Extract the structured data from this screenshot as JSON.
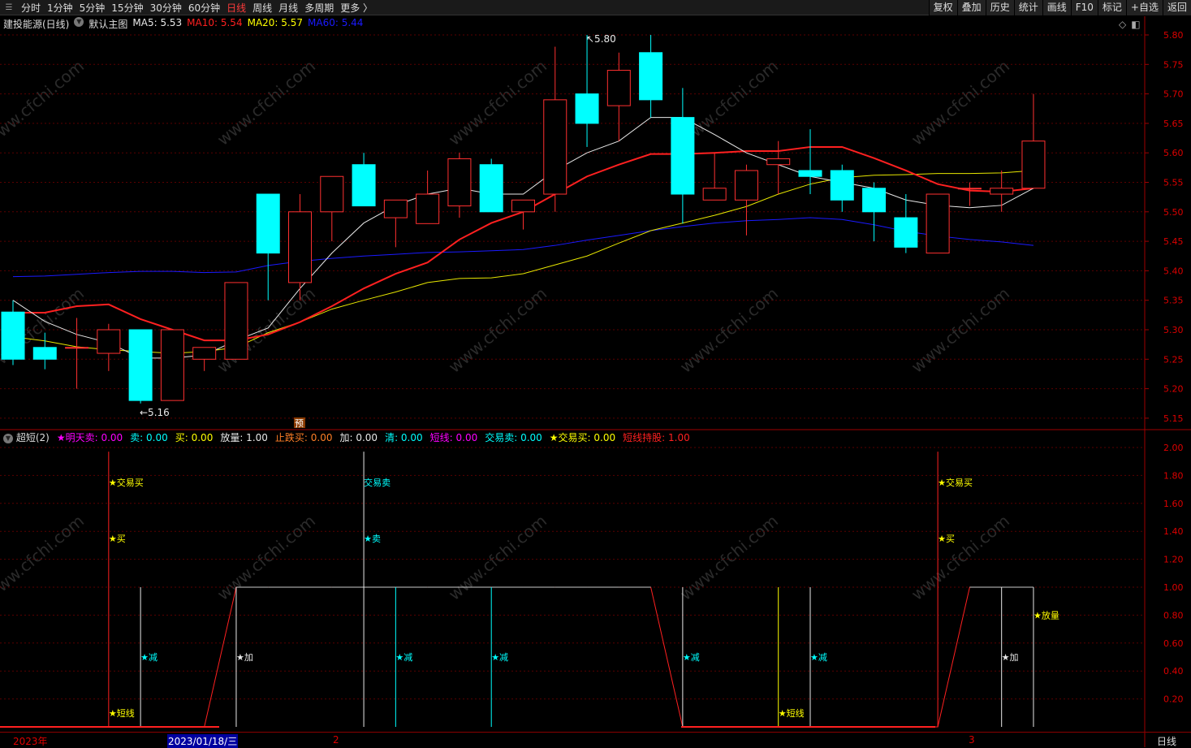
{
  "topbar": {
    "periods": [
      "分时",
      "1分钟",
      "5分钟",
      "15分钟",
      "30分钟",
      "60分钟",
      "日线",
      "周线",
      "月线",
      "多周期",
      "更多 〉"
    ],
    "active_index": 6,
    "buttons": [
      "复权",
      "叠加",
      "历史",
      "统计",
      "画线",
      "F10",
      "标记",
      "+自选",
      "返回"
    ]
  },
  "main": {
    "title": "建投能源(日线)",
    "indicator": "默认主图",
    "ma": [
      {
        "label": "MA5: 5.53",
        "color": "#e8e8e8"
      },
      {
        "label": "MA10: 5.54",
        "color": "#ff2020"
      },
      {
        "label": "MA20: 5.57",
        "color": "#ffff00"
      },
      {
        "label": "MA60: 5.44",
        "color": "#1a1aff"
      }
    ],
    "high_label": "5.80",
    "low_label": "5.16",
    "marker": "预",
    "yticks": [
      "5.80",
      "5.75",
      "5.70",
      "5.65",
      "5.60",
      "5.55",
      "5.50",
      "5.45",
      "5.40",
      "5.35",
      "5.30",
      "5.25",
      "5.20",
      "5.15"
    ]
  },
  "sub": {
    "title": "超短(2)",
    "items": [
      {
        "label": "★明天卖: 0.00",
        "color": "#ff00ff"
      },
      {
        "label": "卖: 0.00",
        "color": "#00ffff"
      },
      {
        "label": "买: 0.00",
        "color": "#ffff00"
      },
      {
        "label": "放量: 1.00",
        "color": "#e8e8e8"
      },
      {
        "label": "止跌买: 0.00",
        "color": "#ff7f27"
      },
      {
        "label": "加: 0.00",
        "color": "#e8e8e8"
      },
      {
        "label": "清: 0.00",
        "color": "#00ffff"
      },
      {
        "label": "短线: 0.00",
        "color": "#ff00ff"
      },
      {
        "label": "交易卖: 0.00",
        "color": "#00ffff"
      },
      {
        "label": "★交易买: 0.00",
        "color": "#ffff00"
      },
      {
        "label": "短线持股: 1.00",
        "color": "#ff2020"
      }
    ],
    "yticks": [
      "2.00",
      "1.80",
      "1.60",
      "1.40",
      "1.20",
      "1.00",
      "0.80",
      "0.60",
      "0.40",
      "0.20"
    ]
  },
  "timeaxis": {
    "year": "2023年",
    "selected": "2023/01/18/三",
    "m2": "2",
    "m3": "3",
    "period": "日线"
  },
  "watermark": "www.cfchi.com",
  "chart_data": {
    "type": "candlestick",
    "ylim": [
      5.15,
      5.8
    ],
    "candles": [
      [
        5.33,
        5.25,
        5.35,
        5.24
      ],
      [
        5.27,
        5.25,
        5.295,
        5.233
      ],
      [
        5.27,
        5.27,
        5.32,
        5.2
      ],
      [
        5.26,
        5.3,
        5.31,
        5.23
      ],
      [
        5.3,
        5.18,
        5.3,
        5.175
      ],
      [
        5.18,
        5.3,
        5.3,
        5.18
      ],
      [
        5.25,
        5.27,
        5.27,
        5.23
      ],
      [
        5.25,
        5.38,
        5.38,
        5.25
      ],
      [
        5.53,
        5.43,
        5.53,
        5.35
      ],
      [
        5.38,
        5.5,
        5.53,
        5.35
      ],
      [
        5.5,
        5.56,
        5.56,
        5.45
      ],
      [
        5.58,
        5.51,
        5.6,
        5.51
      ],
      [
        5.49,
        5.52,
        5.52,
        5.44
      ],
      [
        5.48,
        5.53,
        5.57,
        5.48
      ],
      [
        5.51,
        5.59,
        5.6,
        5.49
      ],
      [
        5.58,
        5.5,
        5.59,
        5.5
      ],
      [
        5.5,
        5.52,
        5.52,
        5.47
      ],
      [
        5.53,
        5.69,
        5.78,
        5.5
      ],
      [
        5.7,
        5.65,
        5.8,
        5.61
      ],
      [
        5.68,
        5.74,
        5.77,
        5.62
      ],
      [
        5.77,
        5.69,
        5.8,
        5.66
      ],
      [
        5.66,
        5.53,
        5.71,
        5.48
      ],
      [
        5.52,
        5.54,
        5.6,
        5.52
      ],
      [
        5.52,
        5.57,
        5.58,
        5.46
      ],
      [
        5.58,
        5.59,
        5.62,
        5.53
      ],
      [
        5.57,
        5.56,
        5.64,
        5.53
      ],
      [
        5.57,
        5.52,
        5.58,
        5.5
      ],
      [
        5.54,
        5.5,
        5.55,
        5.45
      ],
      [
        5.49,
        5.44,
        5.53,
        5.43
      ],
      [
        5.43,
        5.53,
        5.53,
        5.43
      ],
      [
        5.54,
        5.54,
        5.55,
        5.51
      ],
      [
        5.53,
        5.54,
        5.57,
        5.5
      ],
      [
        5.54,
        5.62,
        5.7,
        5.54
      ]
    ],
    "ma5": [
      5.35,
      5.314,
      5.292,
      5.278,
      5.252,
      5.252,
      5.257,
      5.282,
      5.303,
      5.37,
      5.43,
      5.481,
      5.511,
      5.53,
      5.54,
      5.53,
      5.53,
      5.57,
      5.6,
      5.62,
      5.66,
      5.66,
      5.631,
      5.6,
      5.58,
      5.56,
      5.55,
      5.54,
      5.52,
      5.511,
      5.507,
      5.511,
      5.54
    ],
    "ma10": [
      5.329,
      5.329,
      5.34,
      5.343,
      5.318,
      5.3,
      5.282,
      5.282,
      5.292,
      5.313,
      5.34,
      5.37,
      5.395,
      5.414,
      5.453,
      5.481,
      5.5,
      5.53,
      5.56,
      5.58,
      5.598,
      5.598,
      5.6,
      5.603,
      5.603,
      5.61,
      5.61,
      5.591,
      5.57,
      5.547,
      5.536,
      5.534,
      5.54
    ],
    "ma20": [
      5.288,
      5.281,
      5.271,
      5.266,
      5.263,
      5.26,
      5.263,
      5.27,
      5.295,
      5.313,
      5.335,
      5.35,
      5.364,
      5.38,
      5.387,
      5.388,
      5.395,
      5.41,
      5.425,
      5.447,
      5.468,
      5.481,
      5.494,
      5.509,
      5.53,
      5.547,
      5.558,
      5.562,
      5.563,
      5.565,
      5.565,
      5.566,
      5.57
    ],
    "ma60": [
      5.39,
      5.391,
      5.394,
      5.397,
      5.399,
      5.399,
      5.397,
      5.398,
      5.409,
      5.416,
      5.421,
      5.425,
      5.428,
      5.431,
      5.432,
      5.434,
      5.436,
      5.443,
      5.452,
      5.46,
      5.468,
      5.475,
      5.481,
      5.485,
      5.487,
      5.49,
      5.487,
      5.478,
      5.467,
      5.459,
      5.453,
      5.449,
      5.443
    ],
    "sub_ylim": [
      0,
      2
    ],
    "hold": [
      0,
      0,
      0,
      0,
      0,
      0,
      0,
      1,
      1,
      1,
      1,
      1,
      1,
      1,
      1,
      1,
      1,
      1,
      1,
      1,
      1,
      0,
      0,
      0,
      0,
      0,
      0,
      0,
      0,
      0,
      1,
      1,
      1
    ],
    "signals": [
      {
        "i": 3,
        "top": 2,
        "color": "#ff2020",
        "labels": [
          {
            "t": "★交易买",
            "v": 1.75,
            "c": "#ffff00"
          },
          {
            "t": "★买",
            "v": 1.35,
            "c": "#ffff00"
          },
          {
            "t": "★短线",
            "v": 0.1,
            "c": "#ffff00"
          }
        ]
      },
      {
        "i": 4,
        "top": 1,
        "color": "#e8e8e8",
        "labels": [
          {
            "t": "★减",
            "v": 0.5,
            "c": "#00ffff"
          }
        ]
      },
      {
        "i": 7,
        "top": 1,
        "color": "#e8e8e8",
        "labels": [
          {
            "t": "★加",
            "v": 0.5,
            "c": "#e8e8e8"
          }
        ]
      },
      {
        "i": 11,
        "top": 2,
        "color": "#e8e8e8",
        "labels": [
          {
            "t": "交易卖",
            "v": 1.75,
            "c": "#00ffff"
          },
          {
            "t": "★卖",
            "v": 1.35,
            "c": "#00ffff"
          }
        ]
      },
      {
        "i": 12,
        "top": 1,
        "color": "#00ffff",
        "labels": [
          {
            "t": "★减",
            "v": 0.5,
            "c": "#00ffff"
          }
        ]
      },
      {
        "i": 15,
        "top": 1,
        "color": "#00ffff",
        "labels": [
          {
            "t": "★减",
            "v": 0.5,
            "c": "#00ffff"
          }
        ]
      },
      {
        "i": 21,
        "top": 1,
        "color": "#e8e8e8",
        "labels": [
          {
            "t": "★减",
            "v": 0.5,
            "c": "#00ffff"
          }
        ]
      },
      {
        "i": 24,
        "top": 1,
        "color": "#ffff00",
        "labels": [
          {
            "t": "★短线",
            "v": 0.1,
            "c": "#ffff00"
          }
        ]
      },
      {
        "i": 25,
        "top": 1,
        "color": "#e8e8e8",
        "labels": [
          {
            "t": "★减",
            "v": 0.5,
            "c": "#00ffff"
          }
        ]
      },
      {
        "i": 29,
        "top": 2,
        "color": "#ff2020",
        "labels": [
          {
            "t": "★交易买",
            "v": 1.75,
            "c": "#ffff00"
          },
          {
            "t": "★买",
            "v": 1.35,
            "c": "#ffff00"
          }
        ]
      },
      {
        "i": 31,
        "top": 1,
        "color": "#e8e8e8",
        "labels": [
          {
            "t": "★加",
            "v": 0.5,
            "c": "#e8e8e8"
          }
        ]
      },
      {
        "i": 32,
        "top": 1,
        "color": "#e8e8e8",
        "labels": [
          {
            "t": "★放量",
            "v": 0.8,
            "c": "#ffff00"
          }
        ]
      }
    ]
  }
}
